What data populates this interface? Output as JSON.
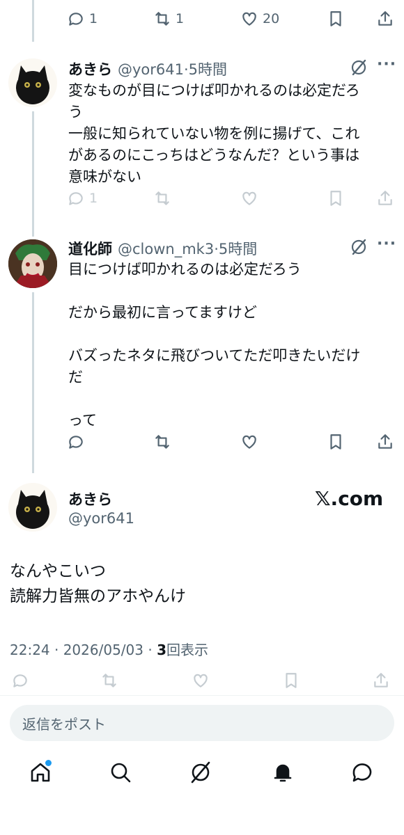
{
  "top_actions": {
    "reply_count": "1",
    "repost_count": "1",
    "like_count": "20"
  },
  "tweet1": {
    "name": "あきら",
    "handle": "@yor641",
    "time": "·5時間",
    "body": "変なものが目につけば叩かれるのは必定だろ\nう\n一般に知られていない物を例に揚げて、これ\nがあるのにこっちはどうなんだ？という事は\n意味がない",
    "reply_count": "1"
  },
  "tweet2": {
    "name": "道化師",
    "handle": "@clown_mk3",
    "time": "·5時間",
    "body": "目につけば叩かれるのは必定だろう\n\nだから最初に言ってますけど\n\nバズったネタに飛びついてただ叩きたいだけ\nだ\n\nって"
  },
  "main_tweet": {
    "name": "あきら",
    "handle": "@yor641",
    "watermark": "𝕏.com",
    "body": "なんやこいつ\n読解力皆無のアホやんけ",
    "time": "22:24 · 2026/05/03 · ",
    "views": "3",
    "views_label": "回表示"
  },
  "reply_placeholder": "返信をポスト",
  "icons": [
    "reply-icon",
    "repost-icon",
    "like-icon",
    "bookmark-icon",
    "share-icon",
    "grok-icon",
    "more-icon",
    "home-icon",
    "search-icon",
    "notifications-icon",
    "messages-icon"
  ],
  "colors": {
    "accent": "#1d9bf0",
    "secondary_text": "#536471",
    "thread_line": "#cfd9de"
  }
}
